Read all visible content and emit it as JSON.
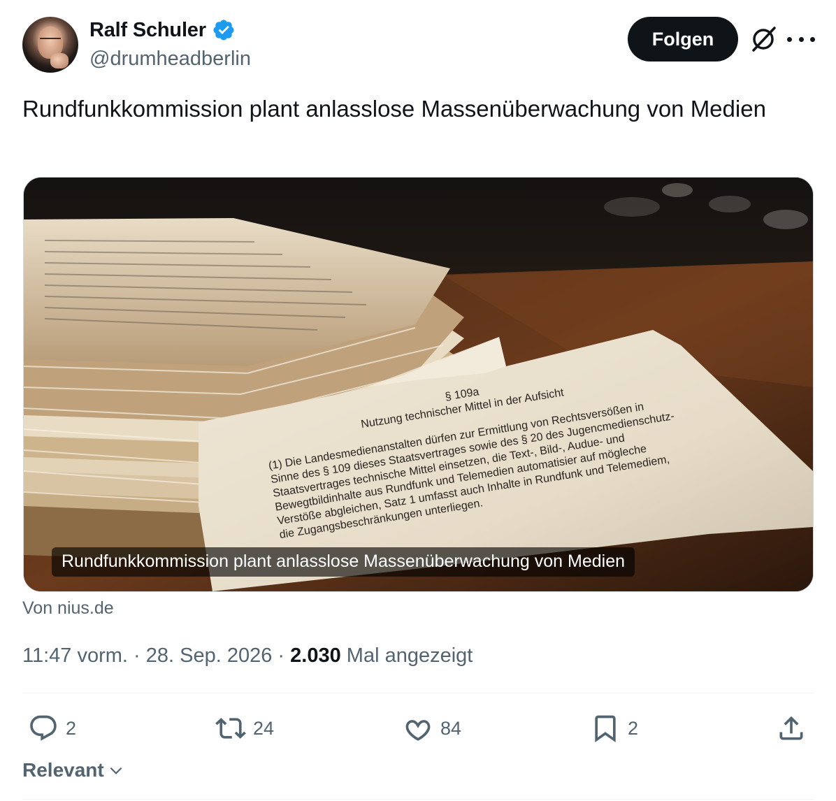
{
  "author": {
    "name": "Ralf Schuler",
    "handle": "@drumheadberlin",
    "verified": true,
    "avatar_icon": "author-avatar"
  },
  "header": {
    "follow_label": "Folgen",
    "grok_icon": "grok-icon",
    "more_icon": "more-dots-icon"
  },
  "tweet": {
    "text": "Rundfunkkommission plant anlasslose Massenüberwachung von Medien"
  },
  "card": {
    "caption": "Rundfunkkommission plant anlasslose Massenüberwachung von Medien",
    "source": "Von nius.de",
    "image_text": {
      "section": "§ 109a",
      "heading": "Nutzung technischer Mittel in der Aufsicht",
      "lines": [
        "(1) Die Landesmedienanstalten dürfen zur Ermittlung von Rechtsversößen in",
        "Sinne des § 109 dieses Staatsvertrages sowie des § 20 des Jugencmedienschutz-",
        "Staatsvertrages technische Mittel einsetzen, die Text-, Bild-, Audue- und",
        "Bewegtbildinhalte aus Rundfunk und Telemedien automatisier auf mögleche",
        "Verstöße abgleichen, Satz 1 umfasst auch Inhalte in Rundfunk und Telemediem,",
        "die Zugangsbeschränkungen unterliegen."
      ]
    }
  },
  "meta": {
    "time": "11:47 vorm.",
    "separator": " · ",
    "date": "28. Sep. 2026",
    "views": "2.030",
    "views_label": " Mal angezeigt"
  },
  "actions": {
    "replies": "2",
    "reposts": "24",
    "likes": "84",
    "bookmarks": "2"
  },
  "sort": {
    "label": "Relevant"
  },
  "colors": {
    "text": "#0f1419",
    "secondary": "#536471",
    "verified": "#1d9bf0",
    "divider": "#eff3f4"
  }
}
